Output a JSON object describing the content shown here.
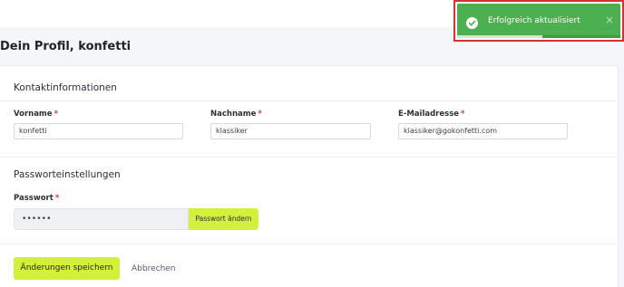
{
  "page": {
    "title": "Dein Profil, konfetti"
  },
  "contact": {
    "section_title": "Kontaktinformationen",
    "first_name": {
      "label": "Vorname",
      "required_mark": "*",
      "value": "konfetti"
    },
    "last_name": {
      "label": "Nachname",
      "required_mark": "*",
      "value": "klassiker"
    },
    "email": {
      "label": "E-Mailadresse",
      "required_mark": "*",
      "value": "klassiker@gokonfetti.com"
    }
  },
  "password": {
    "section_title": "Passworteinstellungen",
    "label": "Passwort",
    "required_mark": "*",
    "masked_value": "••••••",
    "change_button": "Passwort ändern"
  },
  "actions": {
    "save_label": "Änderungen speichern",
    "cancel_label": "Abbrechen"
  },
  "toast": {
    "message": "Erfolgreich aktualisiert",
    "close_glyph": "×",
    "icon": "check-circle-icon",
    "progress": 0.52,
    "color": "#4caf50"
  },
  "colors": {
    "accent": "#d4f03c",
    "required": "#d23b3b",
    "highlight_frame": "#d63232"
  }
}
